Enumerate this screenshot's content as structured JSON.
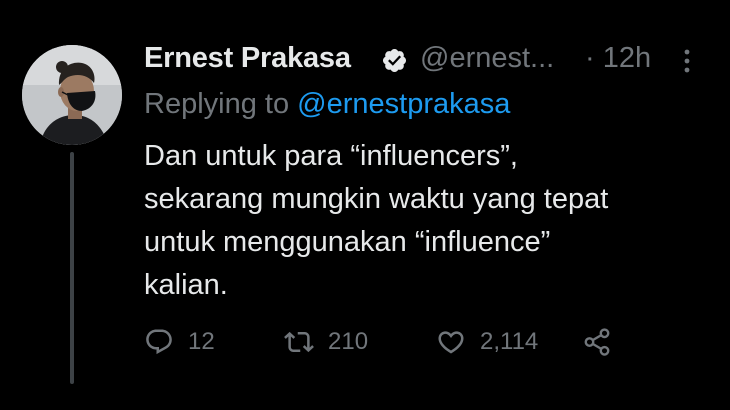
{
  "tweet": {
    "author_name": "Ernest Prakasa",
    "handle": "@ernest...",
    "separator": "·",
    "time": "12h",
    "replying_prefix": "Replying to",
    "replying_to": "@ernestprakasa",
    "body_lines": [
      "Dan untuk para “influencers”,",
      "sekarang mungkin waktu yang tepat",
      "untuk menggunakan “influence”",
      "kalian."
    ],
    "actions": {
      "reply_count": "12",
      "retweet_count": "210",
      "like_count": "2,114"
    }
  },
  "icons": {
    "verified": "verified-badge-icon",
    "more": "more-vertical-icon",
    "reply": "reply-bubble-icon",
    "retweet": "retweet-arrows-icon",
    "like": "heart-outline-icon",
    "share": "share-nodes-icon"
  },
  "colors": {
    "background": "#000000",
    "primary_text": "#e7e9ea",
    "secondary_text": "#71767b",
    "accent_link": "#1d9bf0",
    "thread_line": "#3d4246"
  }
}
